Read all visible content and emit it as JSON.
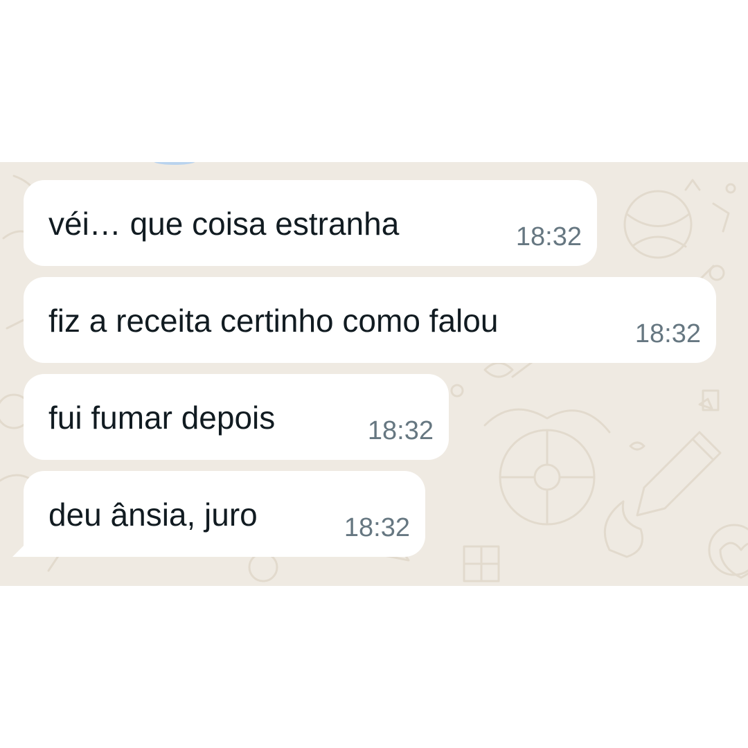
{
  "messages": [
    {
      "text": "véi… que coisa estranha",
      "time": "18:32"
    },
    {
      "text": "fiz a receita certinho como falou",
      "time": "18:32"
    },
    {
      "text": "fui fumar depois",
      "time": "18:32"
    },
    {
      "text": "deu ânsia, juro",
      "time": "18:32"
    }
  ],
  "colors": {
    "chat_background": "#efeae2",
    "bubble": "#ffffff",
    "message_text": "#111b21",
    "timestamp": "#667781"
  }
}
